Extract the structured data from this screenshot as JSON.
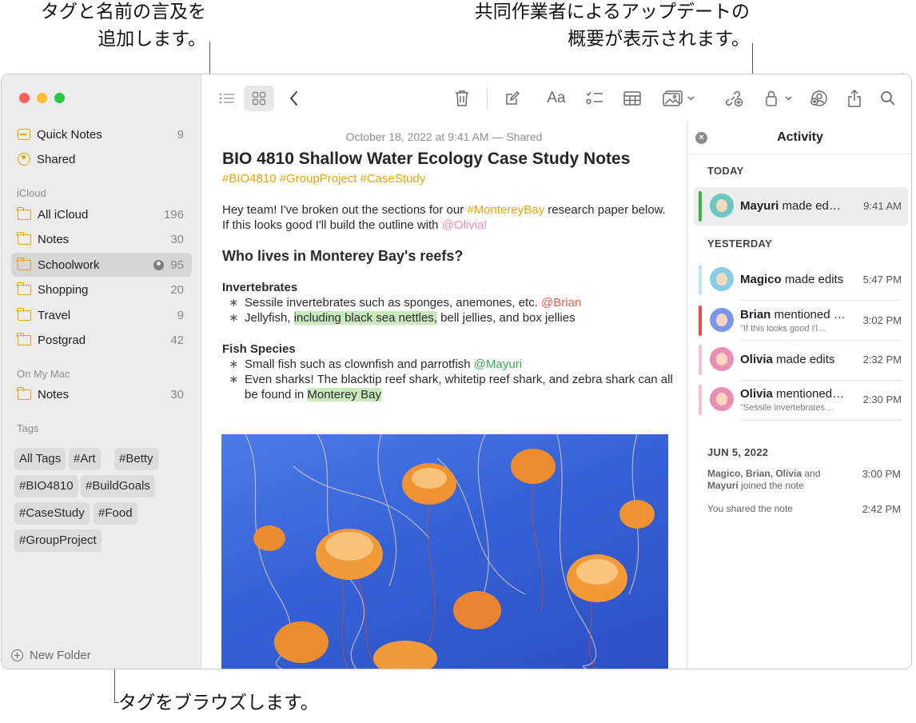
{
  "callouts": {
    "top_left": [
      "タグと名前の言及を",
      "追加します。"
    ],
    "top_right": [
      "共同作業者によるアップデートの",
      "概要が表示されます。"
    ],
    "bottom": "タグをブラウズします。"
  },
  "sidebar": {
    "top_items": [
      {
        "label": "Quick Notes",
        "count": "9",
        "icon": "quick-notes-icon"
      },
      {
        "label": "Shared",
        "count": "",
        "icon": "shared-icon"
      }
    ],
    "icloud_header": "iCloud",
    "icloud_items": [
      {
        "label": "All iCloud",
        "count": "196"
      },
      {
        "label": "Notes",
        "count": "30"
      },
      {
        "label": "Schoolwork",
        "count": "95",
        "selected": true,
        "shared": true
      },
      {
        "label": "Shopping",
        "count": "20"
      },
      {
        "label": "Travel",
        "count": "9"
      },
      {
        "label": "Postgrad",
        "count": "42"
      }
    ],
    "mac_header": "On My Mac",
    "mac_items": [
      {
        "label": "Notes",
        "count": "30"
      }
    ],
    "tags_header": "Tags",
    "tags": [
      "All Tags",
      "#Art",
      "#Betty",
      "#BIO4810",
      "#BuildGoals",
      "#CaseStudy",
      "#Food",
      "#GroupProject"
    ],
    "new_folder": "New Folder"
  },
  "toolbar": {
    "icons": [
      "list-view-icon",
      "gallery-view-icon",
      "back-chevron-icon",
      "trash-icon",
      "compose-icon",
      "format-text-icon",
      "checklist-icon",
      "table-icon",
      "media-icon",
      "collaborate-icon",
      "lock-icon",
      "share-people-icon",
      "share-icon",
      "search-icon"
    ],
    "format_label": "Aa"
  },
  "note": {
    "date": "October 18, 2022 at 9:41 AM — Shared",
    "title": "BIO 4810 Shallow Water Ecology Case Study Notes",
    "tags": "#BIO4810 #GroupProject #CaseStudy",
    "intro_1": "Hey team! I've broken out the sections for our ",
    "intro_tag": "#MontereyBay",
    "intro_2": " research paper below. If this looks good I'll build the outline with ",
    "intro_mention": "@Olivia!",
    "heading": "Who lives in Monterey Bay's reefs?",
    "section1": "Invertebrates",
    "b1_text": "Sessile invertebrates such as sponges, anemones, etc. ",
    "b1_mention": "@Brian",
    "b2_pre": "Jellyfish, ",
    "b2_highlight": "including black sea nettles,",
    "b2_post": " bell jellies, and box jellies",
    "section2": "Fish Species",
    "b3_text": "Small fish such as clownfish and parrotfish ",
    "b3_mention": "@Mayuri",
    "b4_text": "Even sharks! The blacktip reef shark, whitetip reef shark, and zebra shark can all be found in ",
    "b4_highlight": "Monterey Bay",
    "bullet_char": "∗"
  },
  "activity": {
    "title": "Activity",
    "today": "TODAY",
    "yesterday": "YESTERDAY",
    "earlier": "JUN 5, 2022",
    "items": [
      {
        "name": "Mayuri",
        "action": " made ed…",
        "sub": "",
        "time": "9:41 AM",
        "bar": "#38b24a",
        "avatar": "#6ec6c2"
      },
      {
        "name": "Magico",
        "action": " made edits",
        "sub": "",
        "time": "5:47 PM",
        "bar": "#bfe4f6",
        "avatar": "#88cde8"
      },
      {
        "name": "Brian",
        "action": " mentioned L…",
        "sub": "\"If this looks good I'l…",
        "time": "3:02 PM",
        "bar": "#e84b3f",
        "avatar": "#7b96e8"
      },
      {
        "name": "Olivia",
        "action": " made edits",
        "sub": "",
        "time": "2:32 PM",
        "bar": "#f6bfd3",
        "avatar": "#e88fb5"
      },
      {
        "name": "Olivia",
        "action": " mentioned…",
        "sub": "\"Sessile invertebrates…",
        "time": "2:30 PM",
        "bar": "#f6bfd3",
        "avatar": "#e88fb5"
      }
    ],
    "note1_bold": "Magico, Brian, Olivia",
    "note1_mid": " and ",
    "note1_bold2": "Mayuri",
    "note1_rest": " joined the note",
    "note1_time": "3:00 PM",
    "note2": "You shared the note",
    "note2_time": "2:42 PM"
  }
}
